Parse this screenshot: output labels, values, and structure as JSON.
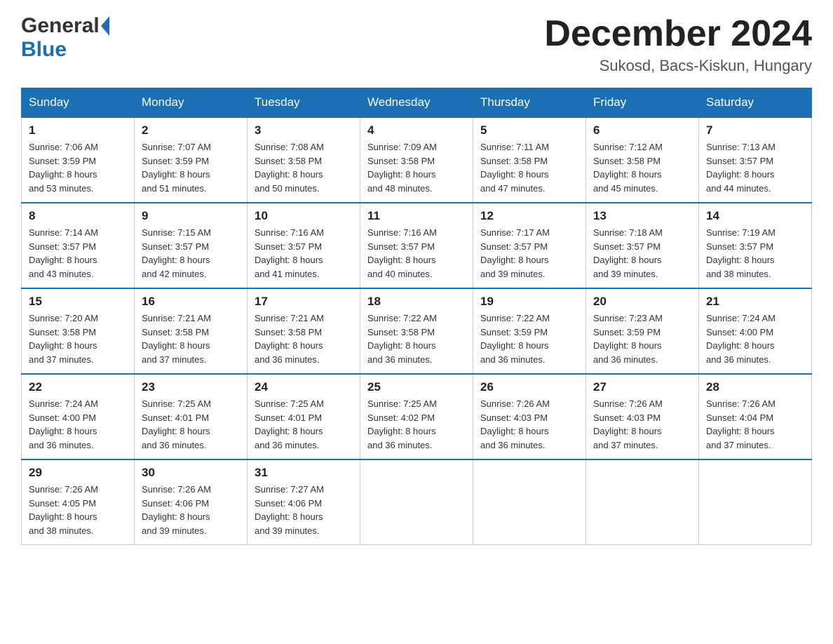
{
  "header": {
    "logo": {
      "general": "General",
      "blue": "Blue"
    },
    "title": "December 2024",
    "subtitle": "Sukosd, Bacs-Kiskun, Hungary"
  },
  "days_of_week": [
    "Sunday",
    "Monday",
    "Tuesday",
    "Wednesday",
    "Thursday",
    "Friday",
    "Saturday"
  ],
  "weeks": [
    [
      {
        "day": "1",
        "sunrise": "7:06 AM",
        "sunset": "3:59 PM",
        "daylight": "8 hours and 53 minutes."
      },
      {
        "day": "2",
        "sunrise": "7:07 AM",
        "sunset": "3:59 PM",
        "daylight": "8 hours and 51 minutes."
      },
      {
        "day": "3",
        "sunrise": "7:08 AM",
        "sunset": "3:58 PM",
        "daylight": "8 hours and 50 minutes."
      },
      {
        "day": "4",
        "sunrise": "7:09 AM",
        "sunset": "3:58 PM",
        "daylight": "8 hours and 48 minutes."
      },
      {
        "day": "5",
        "sunrise": "7:11 AM",
        "sunset": "3:58 PM",
        "daylight": "8 hours and 47 minutes."
      },
      {
        "day": "6",
        "sunrise": "7:12 AM",
        "sunset": "3:58 PM",
        "daylight": "8 hours and 45 minutes."
      },
      {
        "day": "7",
        "sunrise": "7:13 AM",
        "sunset": "3:57 PM",
        "daylight": "8 hours and 44 minutes."
      }
    ],
    [
      {
        "day": "8",
        "sunrise": "7:14 AM",
        "sunset": "3:57 PM",
        "daylight": "8 hours and 43 minutes."
      },
      {
        "day": "9",
        "sunrise": "7:15 AM",
        "sunset": "3:57 PM",
        "daylight": "8 hours and 42 minutes."
      },
      {
        "day": "10",
        "sunrise": "7:16 AM",
        "sunset": "3:57 PM",
        "daylight": "8 hours and 41 minutes."
      },
      {
        "day": "11",
        "sunrise": "7:16 AM",
        "sunset": "3:57 PM",
        "daylight": "8 hours and 40 minutes."
      },
      {
        "day": "12",
        "sunrise": "7:17 AM",
        "sunset": "3:57 PM",
        "daylight": "8 hours and 39 minutes."
      },
      {
        "day": "13",
        "sunrise": "7:18 AM",
        "sunset": "3:57 PM",
        "daylight": "8 hours and 39 minutes."
      },
      {
        "day": "14",
        "sunrise": "7:19 AM",
        "sunset": "3:57 PM",
        "daylight": "8 hours and 38 minutes."
      }
    ],
    [
      {
        "day": "15",
        "sunrise": "7:20 AM",
        "sunset": "3:58 PM",
        "daylight": "8 hours and 37 minutes."
      },
      {
        "day": "16",
        "sunrise": "7:21 AM",
        "sunset": "3:58 PM",
        "daylight": "8 hours and 37 minutes."
      },
      {
        "day": "17",
        "sunrise": "7:21 AM",
        "sunset": "3:58 PM",
        "daylight": "8 hours and 36 minutes."
      },
      {
        "day": "18",
        "sunrise": "7:22 AM",
        "sunset": "3:58 PM",
        "daylight": "8 hours and 36 minutes."
      },
      {
        "day": "19",
        "sunrise": "7:22 AM",
        "sunset": "3:59 PM",
        "daylight": "8 hours and 36 minutes."
      },
      {
        "day": "20",
        "sunrise": "7:23 AM",
        "sunset": "3:59 PM",
        "daylight": "8 hours and 36 minutes."
      },
      {
        "day": "21",
        "sunrise": "7:24 AM",
        "sunset": "4:00 PM",
        "daylight": "8 hours and 36 minutes."
      }
    ],
    [
      {
        "day": "22",
        "sunrise": "7:24 AM",
        "sunset": "4:00 PM",
        "daylight": "8 hours and 36 minutes."
      },
      {
        "day": "23",
        "sunrise": "7:25 AM",
        "sunset": "4:01 PM",
        "daylight": "8 hours and 36 minutes."
      },
      {
        "day": "24",
        "sunrise": "7:25 AM",
        "sunset": "4:01 PM",
        "daylight": "8 hours and 36 minutes."
      },
      {
        "day": "25",
        "sunrise": "7:25 AM",
        "sunset": "4:02 PM",
        "daylight": "8 hours and 36 minutes."
      },
      {
        "day": "26",
        "sunrise": "7:26 AM",
        "sunset": "4:03 PM",
        "daylight": "8 hours and 36 minutes."
      },
      {
        "day": "27",
        "sunrise": "7:26 AM",
        "sunset": "4:03 PM",
        "daylight": "8 hours and 37 minutes."
      },
      {
        "day": "28",
        "sunrise": "7:26 AM",
        "sunset": "4:04 PM",
        "daylight": "8 hours and 37 minutes."
      }
    ],
    [
      {
        "day": "29",
        "sunrise": "7:26 AM",
        "sunset": "4:05 PM",
        "daylight": "8 hours and 38 minutes."
      },
      {
        "day": "30",
        "sunrise": "7:26 AM",
        "sunset": "4:06 PM",
        "daylight": "8 hours and 39 minutes."
      },
      {
        "day": "31",
        "sunrise": "7:27 AM",
        "sunset": "4:06 PM",
        "daylight": "8 hours and 39 minutes."
      },
      null,
      null,
      null,
      null
    ]
  ],
  "labels": {
    "sunrise": "Sunrise:",
    "sunset": "Sunset:",
    "daylight": "Daylight:"
  }
}
